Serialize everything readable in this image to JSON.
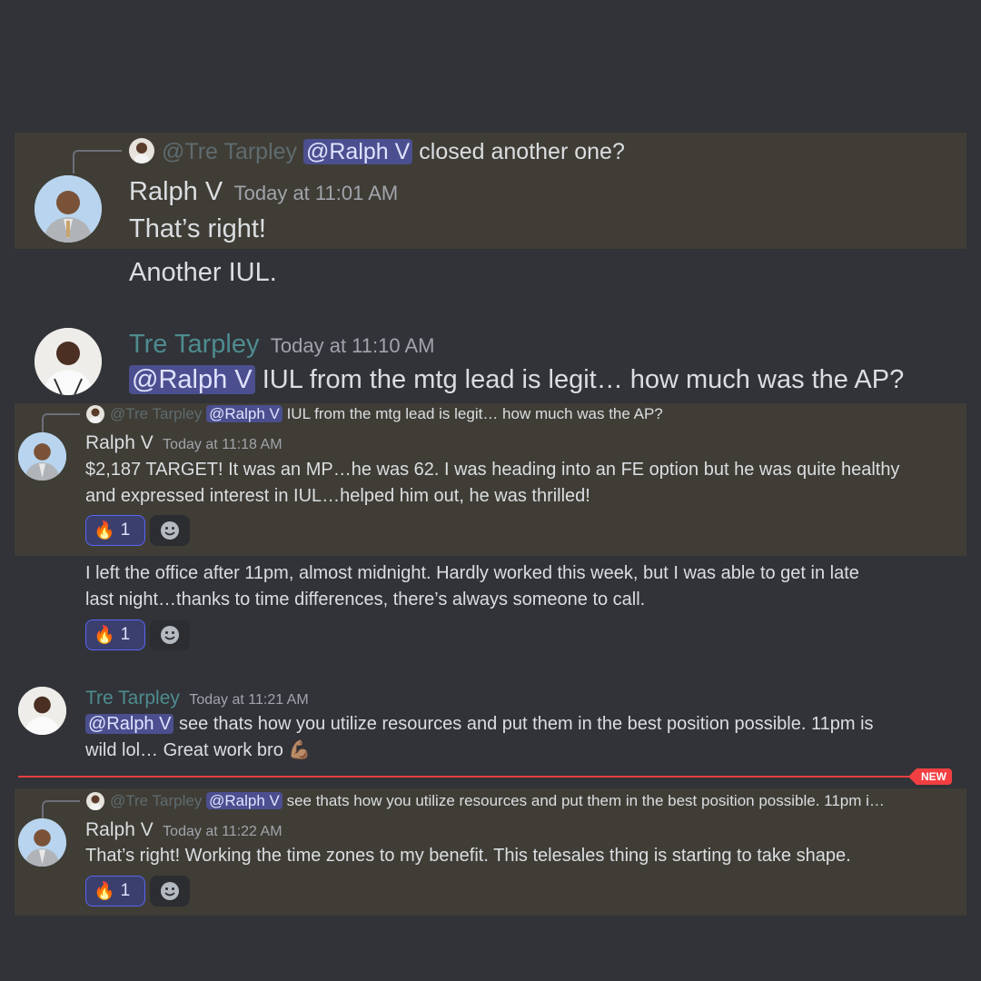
{
  "messages": [
    {
      "reply": {
        "author": "@Tre Tarpley",
        "mention": "@Ralph V",
        "text": "closed another one?"
      },
      "author": "Ralph V",
      "time": "Today at 11:01 AM",
      "lines": [
        "That’s right!",
        "Another IUL."
      ]
    },
    {
      "author": "Tre Tarpley",
      "time": "Today at 11:10 AM",
      "mention": "@Ralph V",
      "text": "IUL from the mtg lead is legit… how much was the AP?"
    },
    {
      "reply": {
        "author": "@Tre Tarpley",
        "mention": "@Ralph V",
        "text": "IUL from the mtg lead is legit… how much was the AP?"
      },
      "author": "Ralph V",
      "time": "Today at 11:18 AM",
      "lines": [
        "$2,187 TARGET! It was an MP…he was 62. I was heading into an FE option but he was quite healthy",
        "and expressed interest in IUL…helped him out, he was thrilled!"
      ],
      "reaction": {
        "emoji": "🔥",
        "count": "1"
      }
    },
    {
      "lines": [
        "I left the office after 11pm, almost midnight. Hardly worked this week, but I was able to get in late",
        "last night…thanks to time differences, there’s always someone to call."
      ],
      "reaction": {
        "emoji": "🔥",
        "count": "1"
      }
    },
    {
      "author": "Tre Tarpley",
      "time": "Today at 11:21 AM",
      "mention": "@Ralph V",
      "line1": "see thats how you utilize resources and put them in the best position possible. 11pm is",
      "line2": "wild lol… Great work bro",
      "emoji": "💪🏽"
    },
    {
      "reply": {
        "author": "@Tre Tarpley",
        "mention": "@Ralph V",
        "text": "see thats how you utilize resources and put them in the best position possible. 11pm i…"
      },
      "author": "Ralph V",
      "time": "Today at 11:22 AM",
      "lines": [
        "That’s right! Working the time zones to my benefit. This telesales thing is starting to take shape."
      ],
      "reaction": {
        "emoji": "🔥",
        "count": "1"
      }
    }
  ],
  "divider": {
    "label": "NEW",
    "color": "#f23f42"
  },
  "colors": {
    "background": "#313338",
    "highlight": "#3f3d36",
    "mention_bg": "#4b4f8f",
    "tre_name": "#4e8c8f"
  },
  "icons": {
    "reaction_add": "smiley-icon",
    "avatar_ralph": "avatar-ralph",
    "avatar_tre": "avatar-tre"
  }
}
